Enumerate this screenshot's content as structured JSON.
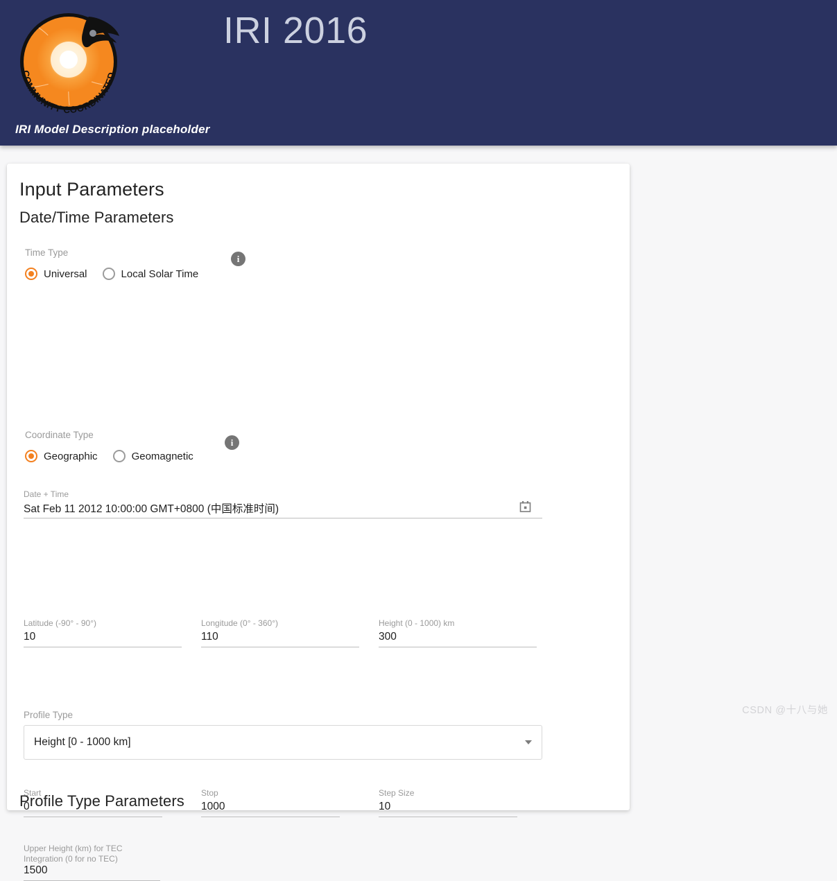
{
  "header": {
    "brand_title": "IRI 2016",
    "model_description": "IRI Model Description placeholder",
    "logo": {
      "icon": "ccmc-sun-logo",
      "ring_text": "COMMUNITY COORDINATED MODELING CENTER",
      "colors": {
        "disc": "#F5881F",
        "outline": "#111111",
        "glow": "#FFFFFF"
      }
    },
    "colors": {
      "background": "#2A3260",
      "title": "#CCD1E0",
      "subtitle": "#FFFFFF"
    }
  },
  "card": {
    "title": "Input Parameters",
    "sections": {
      "datetime": {
        "heading": "Date/Time Parameters",
        "time_type": {
          "label": "Time Type",
          "info_icon": "info-icon",
          "options": [
            {
              "label": "Universal",
              "checked": true
            },
            {
              "label": "Local Solar Time",
              "checked": false
            }
          ],
          "selected": "Universal"
        },
        "datetime_input": {
          "label": "Date + Time",
          "value": "Sat Feb 11 2012 10:00:00 GMT+0800 (中国标准时间)",
          "placeholder": "Date + Time",
          "icon": "calendar-icon"
        },
        "coordinate_type": {
          "label": "Coordinate Type",
          "info_icon": "info-icon",
          "options": [
            {
              "label": "Geographic",
              "checked": true
            },
            {
              "label": "Geomagnetic",
              "checked": false
            }
          ],
          "selected": "Geographic"
        },
        "latitude": {
          "label": "Latitude (-90° - 90°)",
          "value": "10",
          "placeholder": "Latitude"
        },
        "longitude": {
          "label": "Longitude (0° - 360°)",
          "value": "110",
          "placeholder": "Longitude"
        },
        "height": {
          "label": "Height (0 - 1000) km",
          "value": "300",
          "placeholder": "Height"
        }
      },
      "profile": {
        "heading": "Profile Type Parameters",
        "profile_type": {
          "label": "Profile Type",
          "value": "Height [0 - 1000 km]",
          "caret_icon": "chevron-down-icon"
        },
        "start": {
          "label": "Start",
          "value": "0",
          "placeholder": "Start"
        },
        "stop": {
          "label": "Stop",
          "value": "1000",
          "placeholder": "Stop"
        },
        "step_size": {
          "label": "Step Size",
          "value": "10",
          "placeholder": "Step Size"
        },
        "tec": {
          "label": "Upper Height (km) for TEC Integration (0 for no TEC)",
          "value": "1500",
          "placeholder": "Upper Height (km) for TEC Integration (0 for no TEC)"
        }
      }
    }
  },
  "watermark": "CSDN @十八与她",
  "accent_color": "#F3801F"
}
